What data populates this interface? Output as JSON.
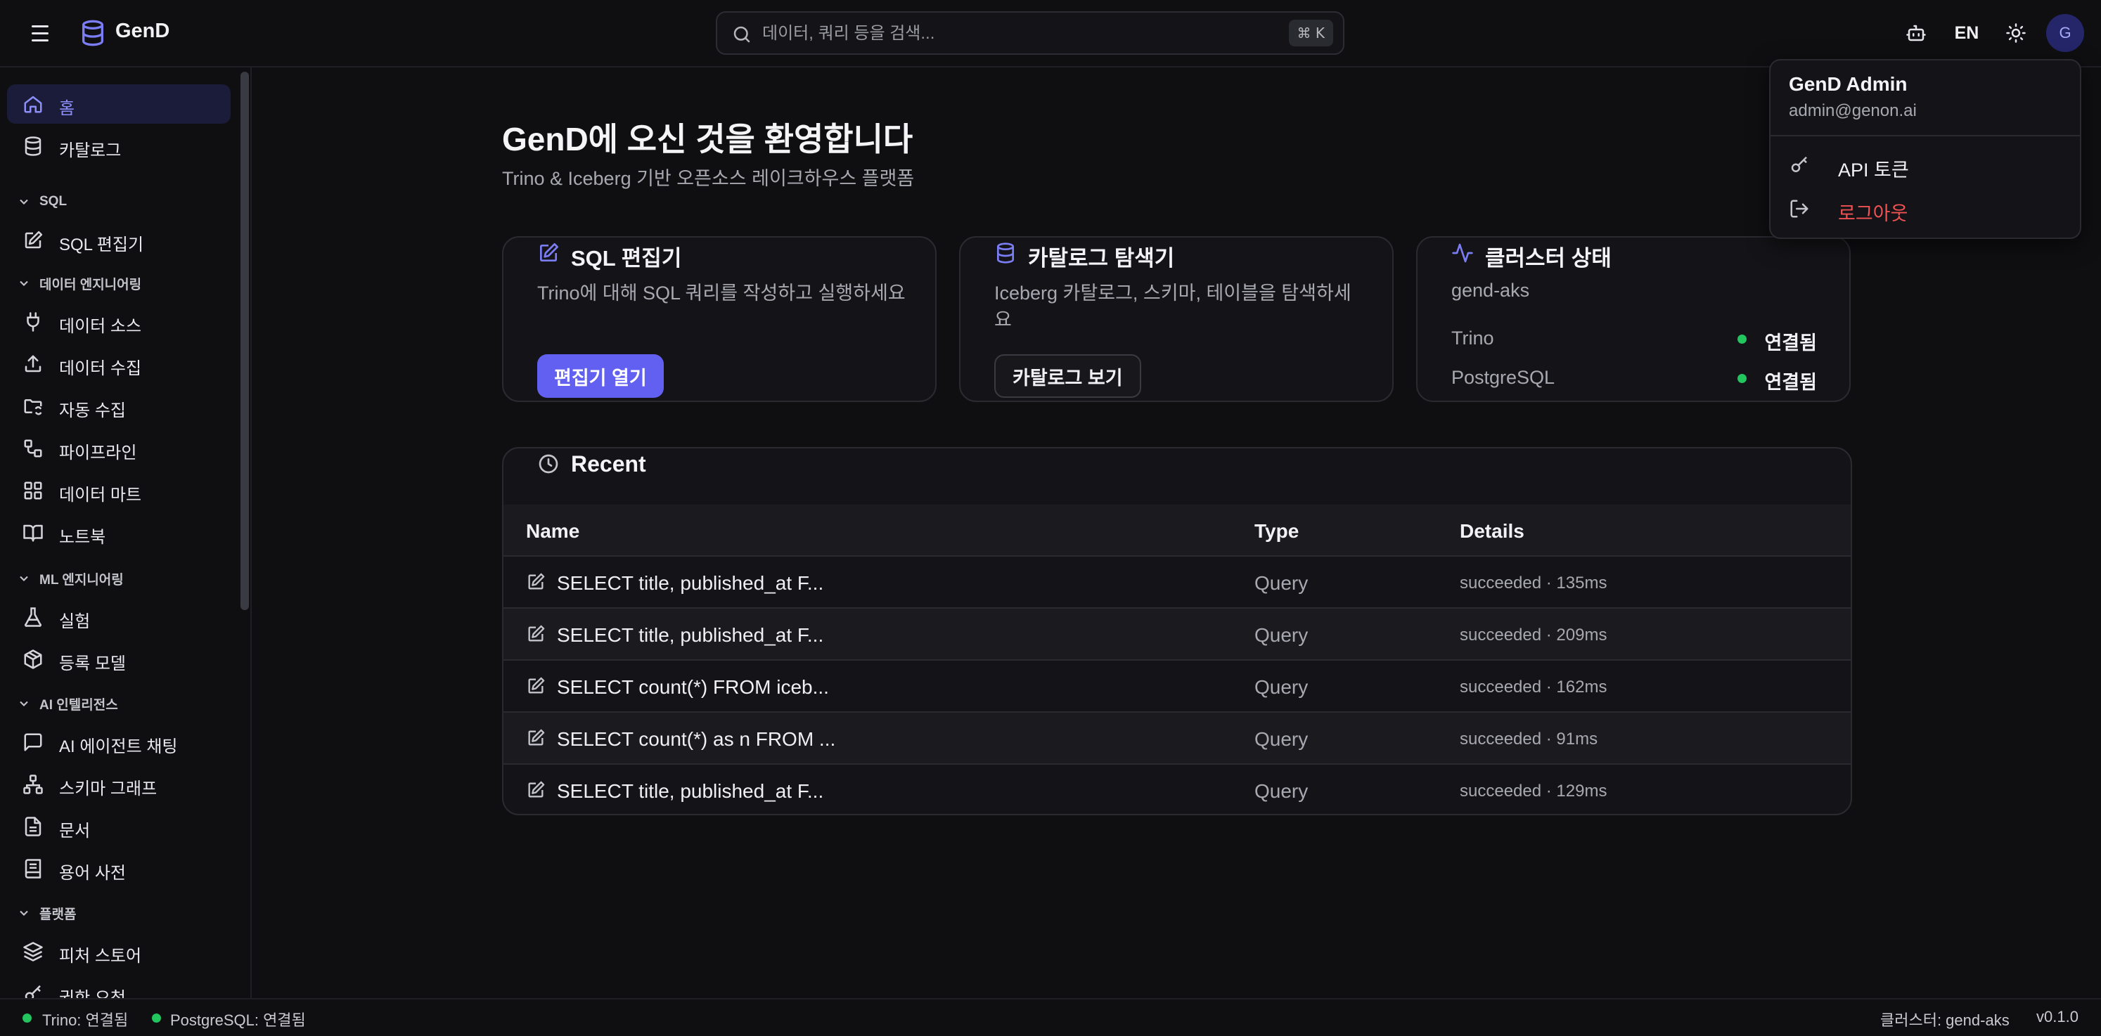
{
  "header": {
    "app_name": "GenD",
    "search_placeholder": "데이터, 쿼리 등을 검색...",
    "search_shortcut": "⌘ K",
    "lang": "EN",
    "avatar_initial": "G"
  },
  "sidebar": {
    "home": "홈",
    "catalog": "카탈로그",
    "sections": {
      "sql": "SQL",
      "data_eng": "데이터 엔지니어링",
      "ml_eng": "ML 엔지니어링",
      "ai": "AI 인텔리전스",
      "platform": "플랫폼"
    },
    "items": {
      "sql_editor": "SQL 편집기",
      "data_source": "데이터 소스",
      "data_ingest": "데이터 수집",
      "auto_ingest": "자동 수집",
      "pipeline": "파이프라인",
      "data_mart": "데이터 마트",
      "notebook": "노트북",
      "experiment": "실험",
      "registered_model": "등록 모델",
      "ai_agent_chat": "AI 에이전트 채팅",
      "schema_graph": "스키마 그래프",
      "documents": "문서",
      "glossary": "용어 사전",
      "feature_store": "피처 스토어",
      "permission_request": "권한 요청"
    }
  },
  "main": {
    "welcome": "GenD에 오신 것을 환영합니다",
    "subtitle": "Trino & Iceberg 기반 오픈소스 레이크하우스 플랫폼",
    "cards": {
      "sql": {
        "title": "SQL 편집기",
        "desc": "Trino에 대해 SQL 쿼리를 작성하고 실행하세요",
        "button": "편집기 열기"
      },
      "catalog": {
        "title": "카탈로그 탐색기",
        "desc": "Iceberg 카탈로그, 스키마, 테이블을 탐색하세요",
        "button": "카탈로그 보기"
      },
      "cluster": {
        "title": "클러스터 상태",
        "cluster_name": "gend-aks",
        "rows": [
          {
            "name": "Trino",
            "status": "연결됨"
          },
          {
            "name": "PostgreSQL",
            "status": "연결됨"
          }
        ]
      }
    },
    "recent": {
      "title": "Recent",
      "columns": {
        "name": "Name",
        "type": "Type",
        "details": "Details"
      },
      "rows": [
        {
          "name": "SELECT title, published_at F...",
          "type": "Query",
          "details": "succeeded · 135ms"
        },
        {
          "name": "SELECT title, published_at F...",
          "type": "Query",
          "details": "succeeded · 209ms"
        },
        {
          "name": "SELECT count(*) FROM iceb...",
          "type": "Query",
          "details": "succeeded · 162ms"
        },
        {
          "name": "SELECT count(*) as n FROM ...",
          "type": "Query",
          "details": "succeeded · 91ms"
        },
        {
          "name": "SELECT title, published_at F...",
          "type": "Query",
          "details": "succeeded · 129ms"
        }
      ]
    }
  },
  "user_menu": {
    "name": "GenD Admin",
    "email": "admin@genon.ai",
    "api_tokens": "API 토큰",
    "logout": "로그아웃"
  },
  "statusbar": {
    "trino": "Trino: 연결됨",
    "postgres": "PostgreSQL: 연결됨",
    "cluster": "클러스터: gend-aks",
    "version": "v0.1.0"
  },
  "colors": {
    "accent": "#6260f0",
    "ok": "#22c55e",
    "danger": "#f05252",
    "background": "#0f0f12"
  }
}
